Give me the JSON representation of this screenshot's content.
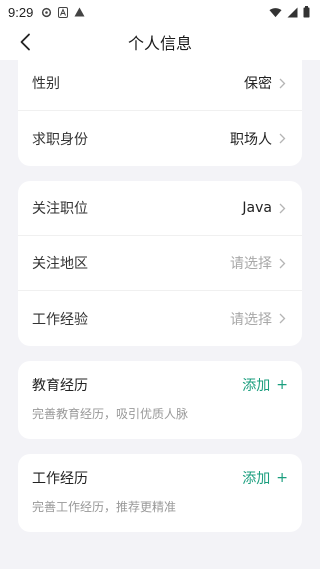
{
  "status_bar": {
    "time": "9:29"
  },
  "nav": {
    "title": "个人信息"
  },
  "card1": {
    "rows": [
      {
        "label": "性别",
        "value": "保密"
      },
      {
        "label": "求职身份",
        "value": "职场人"
      }
    ]
  },
  "card2": {
    "rows": [
      {
        "label": "关注职位",
        "value": "Java"
      },
      {
        "label": "关注地区",
        "value": "请选择"
      },
      {
        "label": "工作经验",
        "value": "请选择"
      }
    ]
  },
  "education": {
    "title": "教育经历",
    "add_label": "添加",
    "add_symbol": "+",
    "desc": "完善教育经历，吸引优质人脉"
  },
  "work": {
    "title": "工作经历",
    "add_label": "添加",
    "add_symbol": "+",
    "desc": "完善工作经历，推荐更精准"
  },
  "colors": {
    "accent": "#1a9e7e",
    "background": "#f3f3f7",
    "placeholder": "#a8a8a8"
  }
}
